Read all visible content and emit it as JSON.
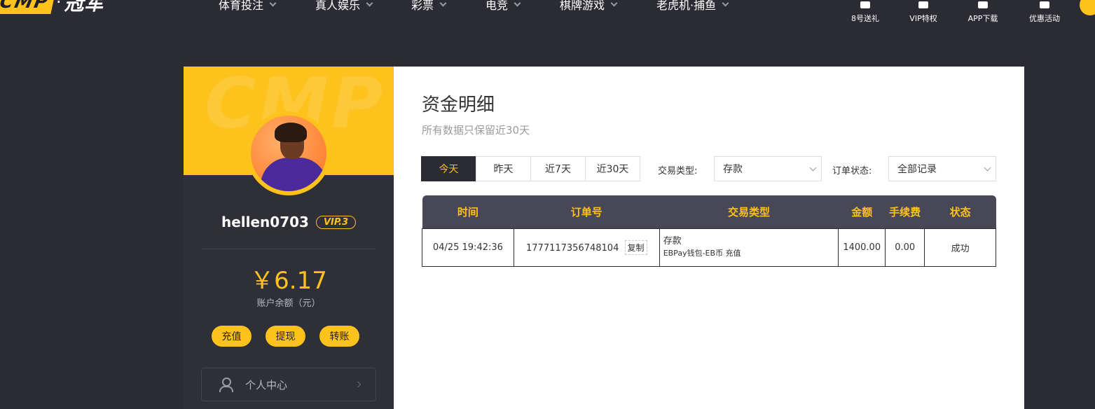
{
  "nav": {
    "logo_mark": "CMP",
    "logo_text": "冠军",
    "items": [
      "体育投注",
      "真人娱乐",
      "彩票",
      "电竞",
      "棋牌游戏",
      "老虎机·捕鱼"
    ],
    "quick_links": [
      "8号送礼",
      "VIP特权",
      "APP下载",
      "优惠活动"
    ]
  },
  "sidebar": {
    "banner_watermark": "CMP",
    "username": "hellen0703",
    "vip": "VIP.3",
    "balance": "￥6.17",
    "balance_label": "账户余额（元）",
    "actions": [
      "充值",
      "提现",
      "转账"
    ],
    "menu_item": "个人中心"
  },
  "main": {
    "title": "资金明细",
    "subtitle": "所有数据只保留近30天",
    "day_tabs": [
      "今天",
      "昨天",
      "近7天",
      "近30天"
    ],
    "active_tab": "今天",
    "type_label": "交易类型:",
    "type_value": "存款",
    "status_label": "订单状态:",
    "status_value": "全部记录",
    "table": {
      "headers": [
        "时间",
        "订单号",
        "交易类型",
        "金额",
        "手续费",
        "状态"
      ],
      "rows": [
        {
          "time": "04/25 19:42:36",
          "order_no": "1777117356748104",
          "copy": "复制",
          "type": "存款",
          "type_detail": "EBPay钱包-EB币 充值",
          "amount": "1400.00",
          "fee": "0.00",
          "status": "成功"
        }
      ]
    }
  },
  "colors": {
    "accent": "#fdc21b",
    "dark": "#2b2b33",
    "success": "#2e8b2e"
  }
}
